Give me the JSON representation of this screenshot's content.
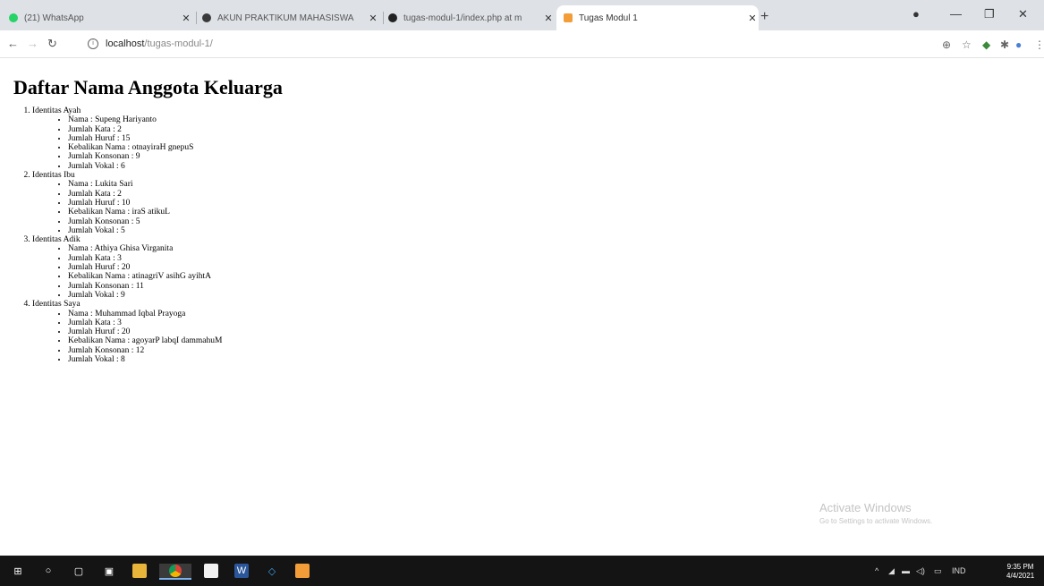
{
  "browser": {
    "tabs": [
      {
        "title": "(21) WhatsApp",
        "color": "#25d366"
      },
      {
        "title": "AKUN PRAKTIKUM MAHASISWA",
        "color": "#3a3a3a"
      },
      {
        "title": "tugas-modul-1/index.php at m",
        "color": "#222222"
      },
      {
        "title": "Tugas Modul 1",
        "color": "#f29d38"
      }
    ],
    "url_host": "localhost",
    "url_path": "/tugas-modul-1/"
  },
  "page": {
    "heading": "Daftar Nama Anggota Keluarga",
    "members": [
      {
        "label": "Identitas Ayah",
        "details": [
          "Nama : Supeng Hariyanto",
          "Jumlah Kata : 2",
          "Jumlah Huruf : 15",
          "Kebalikan Nama : otnayiraH gnepuS",
          "Jumlah Konsonan : 9",
          "Jumlah Vokal : 6"
        ]
      },
      {
        "label": "Identitas Ibu",
        "details": [
          "Nama : Lukita Sari",
          "Jumlah Kata : 2",
          "Jumlah Huruf : 10",
          "Kebalikan Nama : iraS atikuL",
          "Jumlah Konsonan : 5",
          "Jumlah Vokal : 5"
        ]
      },
      {
        "label": "Identitas Adik",
        "details": [
          "Nama : Athiya Ghisa Virganita",
          "Jumlah Kata : 3",
          "Jumlah Huruf : 20",
          "Kebalikan Nama : atinagriV asihG ayihtA",
          "Jumlah Konsonan : 11",
          "Jumlah Vokal : 9"
        ]
      },
      {
        "label": "Identitas Saya",
        "details": [
          "Nama : Muhammad Iqbal Prayoga",
          "Jumlah Kata : 3",
          "Jumlah Huruf : 20",
          "Kebalikan Nama : agoyarP labqI dammahuM",
          "Jumlah Konsonan : 12",
          "Jumlah Vokal : 8"
        ]
      }
    ]
  },
  "watermark": {
    "title": "Activate Windows",
    "subtitle": "Go to Settings to activate Windows."
  },
  "taskbar": {
    "lang": "IND",
    "time": "9:35 PM",
    "date": "4/4/2021"
  }
}
